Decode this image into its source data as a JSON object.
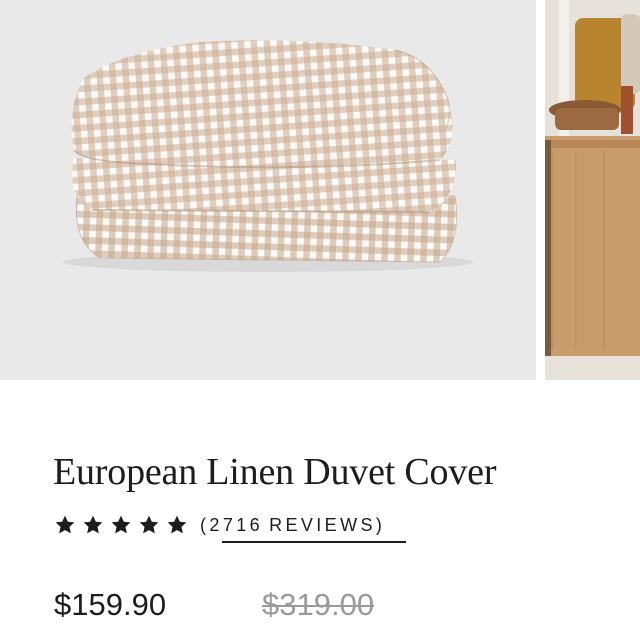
{
  "product": {
    "title": "European Linen Duvet Cover",
    "rating_stars": 5,
    "reviews_open": "(",
    "reviews_count": "2716",
    "reviews_word": "REVIEWS",
    "reviews_close": ")",
    "price": "$159.90",
    "compare_price": "$319.00"
  },
  "gallery": {
    "main_image": "gingham-duvet-folded",
    "next_image": "bedroom-nightstand-preview"
  },
  "colors": {
    "text": "#1d1d1d",
    "muted_price": "#9a9a9a",
    "gingham": "#c9ad92",
    "photo_bg": "#e9e9ea"
  }
}
